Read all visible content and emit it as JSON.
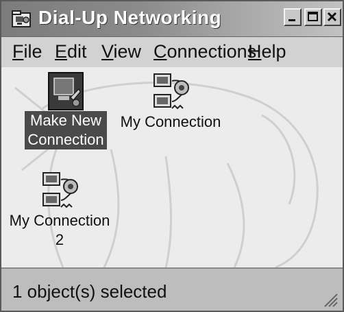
{
  "window": {
    "title": "Dial-Up Networking"
  },
  "menu": {
    "items": [
      {
        "label": "File",
        "accel": "F",
        "rest": "ile"
      },
      {
        "label": "Edit",
        "accel": "E",
        "rest": "dit"
      },
      {
        "label": "View",
        "accel": "V",
        "rest": "iew"
      },
      {
        "label": "Connections",
        "accel": "C",
        "rest": "onnections"
      },
      {
        "label": "Help",
        "accel": "H",
        "rest": "elp"
      }
    ]
  },
  "icons": [
    {
      "line1": "Make New",
      "line2": "Connection",
      "selected": true
    },
    {
      "line1": "My Connection",
      "line2": "",
      "selected": false
    },
    {
      "line1": "My Connection",
      "line2": "2",
      "selected": false
    }
  ],
  "status": {
    "text": "1 object(s) selected"
  }
}
